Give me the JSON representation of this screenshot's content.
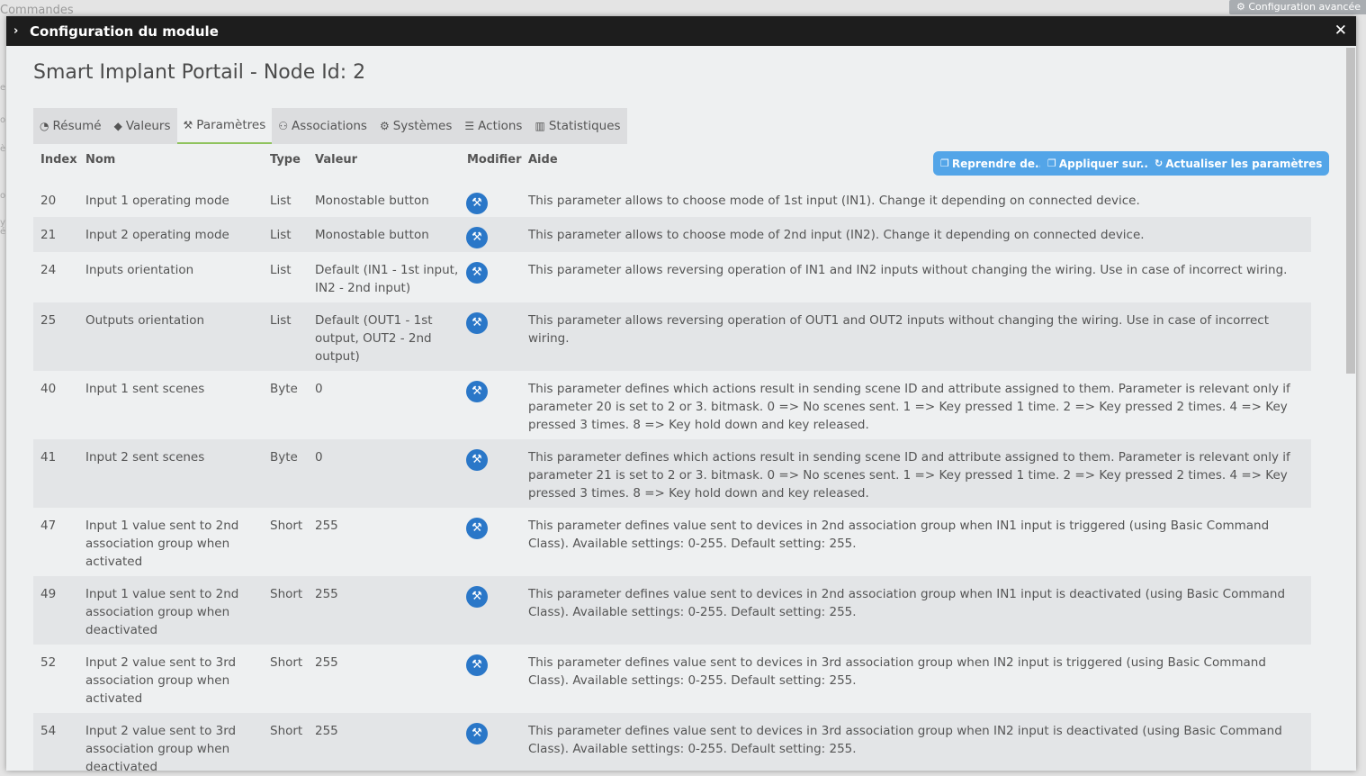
{
  "background": {
    "commandes_label": "Commandes",
    "config_button_label": "Configuration avancée",
    "side_letters": [
      "e",
      "o",
      "è",
      "ol",
      "y",
      "é"
    ]
  },
  "modal": {
    "title": "Configuration du module",
    "close_symbol": "✕",
    "device_title": "Smart Implant Portail - Node Id: 2",
    "tabs": [
      {
        "label": "Résumé",
        "icon": "dashboard-icon",
        "active": false
      },
      {
        "label": "Valeurs",
        "icon": "tag-icon",
        "active": false
      },
      {
        "label": "Paramètres",
        "icon": "wrench-icon",
        "active": true
      },
      {
        "label": "Associations",
        "icon": "users-icon",
        "active": false
      },
      {
        "label": "Systèmes",
        "icon": "cogs-icon",
        "active": false
      },
      {
        "label": "Actions",
        "icon": "bars-icon",
        "active": false
      },
      {
        "label": "Statistiques",
        "icon": "bar-chart-icon",
        "active": false
      }
    ],
    "table": {
      "headers": {
        "index": "Index",
        "nom": "Nom",
        "type": "Type",
        "valeur": "Valeur",
        "modifier": "Modifier",
        "aide": "Aide"
      },
      "buttons": {
        "reprendre": "Reprendre de...",
        "appliquer": "Appliquer sur...",
        "actualiser": "Actualiser les paramètres"
      },
      "rows": [
        {
          "index": "20",
          "nom": "Input 1 operating mode",
          "type": "List",
          "valeur": "Monostable button",
          "aide": "This parameter allows to choose mode of 1st input (IN1). Change it depending on connected device."
        },
        {
          "index": "21",
          "nom": "Input 2 operating mode",
          "type": "List",
          "valeur": "Monostable button",
          "aide": "This parameter allows to choose mode of 2nd input (IN2). Change it depending on connected device."
        },
        {
          "index": "24",
          "nom": "Inputs orientation",
          "type": "List",
          "valeur": "Default (IN1 - 1st input, IN2 - 2nd input)",
          "aide": "This parameter allows reversing operation of IN1 and IN2 inputs without changing the wiring. Use in case of incorrect wiring."
        },
        {
          "index": "25",
          "nom": "Outputs orientation",
          "type": "List",
          "valeur": "Default (OUT1 - 1st output, OUT2 - 2nd output)",
          "aide": "This parameter allows reversing operation of OUT1 and OUT2 inputs without changing the wiring. Use in case of incorrect wiring."
        },
        {
          "index": "40",
          "nom": "Input 1 sent scenes",
          "type": "Byte",
          "valeur": "0",
          "aide": "This parameter defines which actions result in sending scene ID and attribute assigned to them. Parameter is relevant only if parameter 20 is set to 2 or 3. bitmask. 0 => No scenes sent. 1 => Key pressed 1 time. 2 => Key pressed 2 times. 4 => Key pressed 3 times. 8 => Key hold down and key released."
        },
        {
          "index": "41",
          "nom": "Input 2 sent scenes",
          "type": "Byte",
          "valeur": "0",
          "aide": "This parameter defines which actions result in sending scene ID and attribute assigned to them. Parameter is relevant only if parameter 21 is set to 2 or 3. bitmask. 0 => No scenes sent. 1 => Key pressed 1 time. 2 => Key pressed 2 times. 4 => Key pressed 3 times. 8 => Key hold down and key released."
        },
        {
          "index": "47",
          "nom": "Input 1 value sent to 2nd association group when activated",
          "type": "Short",
          "valeur": "255",
          "aide": "This parameter defines value sent to devices in 2nd association group when IN1 input is triggered (using Basic Command Class). Available settings: 0-255. Default setting: 255."
        },
        {
          "index": "49",
          "nom": "Input 1 value sent to 2nd association group when deactivated",
          "type": "Short",
          "valeur": "255",
          "aide": "This parameter defines value sent to devices in 2nd association group when IN1 input is deactivated (using Basic Command Class). Available settings: 0-255. Default setting: 255."
        },
        {
          "index": "52",
          "nom": "Input 2 value sent to 3rd association group when activated",
          "type": "Short",
          "valeur": "255",
          "aide": "This parameter defines value sent to devices in 3rd association group when IN2 input is triggered (using Basic Command Class). Available settings: 0-255. Default setting: 255."
        },
        {
          "index": "54",
          "nom": "Input 2 value sent to 3rd association group when deactivated",
          "type": "Short",
          "valeur": "255",
          "aide": "This parameter defines value sent to devices in 3rd association group when IN2 input is deactivated (using Basic Command Class). Available settings: 0-255. Default setting: 255."
        }
      ]
    }
  }
}
